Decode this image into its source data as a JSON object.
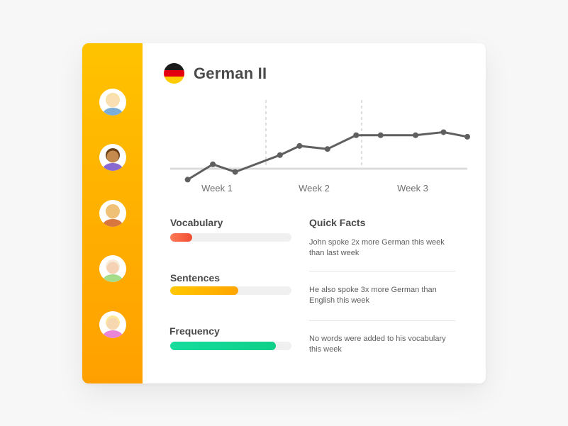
{
  "course": {
    "title": "German II"
  },
  "students": [
    {
      "icon": "avatar-blonde-icon",
      "skin": "#f9dfb2",
      "hair": "#f7e1a6",
      "shirt": "#7aaed8"
    },
    {
      "icon": "avatar-brown-hair-icon",
      "skin": "#c58b4e",
      "hair": "#6b3f16",
      "shirt": "#8a6ad0"
    },
    {
      "icon": "avatar-bald-icon",
      "skin": "#efc176",
      "hair": "#efc176",
      "shirt": "#d8763f"
    },
    {
      "icon": "avatar-light-hair-icon",
      "skin": "#f6d2b4",
      "hair": "#f7ebda",
      "shirt": "#a6dd8a"
    },
    {
      "icon": "avatar-yellow-hair-icon",
      "skin": "#f6d7b0",
      "hair": "#fde89b",
      "shirt": "#ea86d8"
    }
  ],
  "chart_data": {
    "type": "line",
    "categories": [
      "Week 1",
      "Week 2",
      "Week 3"
    ],
    "series": [
      {
        "values": [
          1.0,
          2.0,
          1.5,
          2.6,
          3.2,
          3.0,
          3.9,
          3.9,
          3.9,
          4.1,
          3.8
        ]
      }
    ],
    "ylim": [
      0,
      5
    ],
    "color": "#5f5f5f"
  },
  "metrics": [
    {
      "label": "Vocabulary",
      "fraction": 0.18,
      "color_from": "#fe7a58",
      "color_to": "#f14e33"
    },
    {
      "label": "Sentences",
      "fraction": 0.56,
      "color_from": "#ffc800",
      "color_to": "#ffa400"
    },
    {
      "label": "Frequency",
      "fraction": 0.87,
      "color_from": "#16dc9c",
      "color_to": "#0fd08a"
    }
  ],
  "quick_facts": {
    "title": "Quick Facts",
    "items": [
      "John spoke 2x more German this week than last week",
      "He also spoke 3x more German than English this week",
      "No words were added to his vocabulary this week"
    ]
  }
}
